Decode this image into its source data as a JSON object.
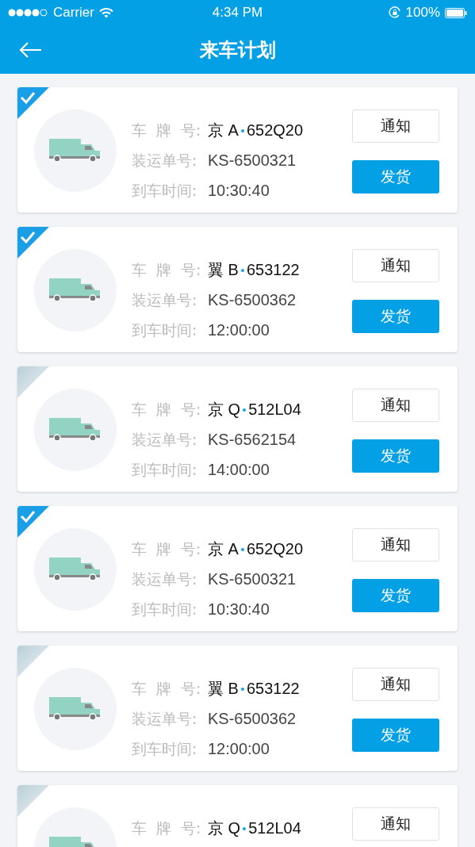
{
  "status_bar": {
    "carrier": "Carrier",
    "time": "4:34 PM",
    "battery": "100%"
  },
  "nav": {
    "title": "来车计划"
  },
  "cards": [
    {
      "selected": true,
      "plate_label": "车 牌 号:",
      "province": "京",
      "letter": "A",
      "number": "652Q20",
      "waybill_label": "装运单号:",
      "waybill": "KS-6500321",
      "arrival_label": "到车时间:",
      "arrival": "10:30:40",
      "notify": "通知",
      "ship": "发货"
    },
    {
      "selected": true,
      "plate_label": "车 牌 号:",
      "province": "翼",
      "letter": "B",
      "number": "653122",
      "waybill_label": "装运单号:",
      "waybill": "KS-6500362",
      "arrival_label": "到车时间:",
      "arrival": "12:00:00",
      "notify": "通知",
      "ship": "发货"
    },
    {
      "selected": false,
      "plate_label": "车 牌 号:",
      "province": "京",
      "letter": "Q",
      "number": "512L04",
      "waybill_label": "装运单号:",
      "waybill": "KS-6562154",
      "arrival_label": "到车时间:",
      "arrival": "14:00:00",
      "notify": "通知",
      "ship": "发货"
    },
    {
      "selected": true,
      "plate_label": "车 牌 号:",
      "province": "京",
      "letter": "A",
      "number": "652Q20",
      "waybill_label": "装运单号:",
      "waybill": "KS-6500321",
      "arrival_label": "到车时间:",
      "arrival": "10:30:40",
      "notify": "通知",
      "ship": "发货"
    },
    {
      "selected": false,
      "plate_label": "车 牌 号:",
      "province": "翼",
      "letter": "B",
      "number": "653122",
      "waybill_label": "装运单号:",
      "waybill": "KS-6500362",
      "arrival_label": "到车时间:",
      "arrival": "12:00:00",
      "notify": "通知",
      "ship": "发货"
    },
    {
      "selected": false,
      "plate_label": "车 牌 号:",
      "province": "京",
      "letter": "Q",
      "number": "512L04",
      "notify": "通知"
    }
  ]
}
